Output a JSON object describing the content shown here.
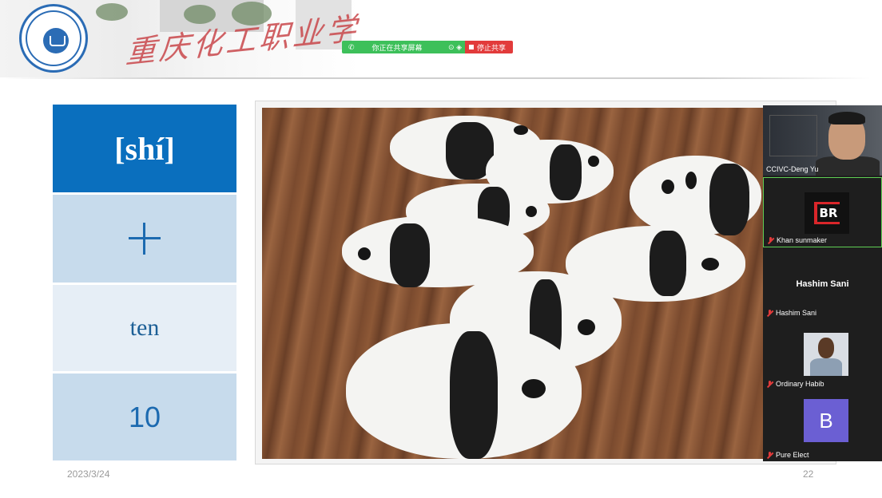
{
  "share_bar": {
    "status_label": "你正在共享屏幕",
    "stop_label": "停止共享"
  },
  "slide": {
    "pinyin": "[shí]",
    "english": "ten",
    "number": "10",
    "date": "2023/3/24",
    "page_number": "22"
  },
  "participants": [
    {
      "name": "CCIVC-Deng Yu",
      "type": "video"
    },
    {
      "name": "Khan sunmaker",
      "type": "avatar",
      "avatar_text": "BR",
      "muted": true
    },
    {
      "name": "Hashim Sani",
      "type": "name-only",
      "display_name": "Hashim Sani",
      "muted": true
    },
    {
      "name": "Ordinary Habib",
      "type": "photo",
      "muted": true
    },
    {
      "name": "Pure Elect",
      "type": "letter",
      "avatar_letter": "B",
      "muted": true
    }
  ]
}
